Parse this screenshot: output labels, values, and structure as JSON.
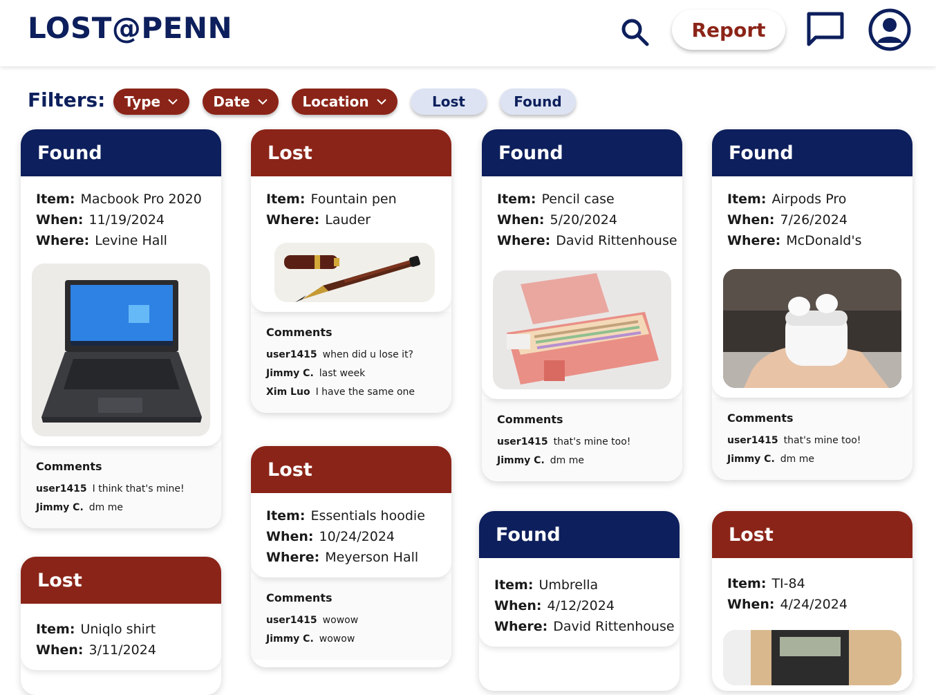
{
  "header": {
    "logo": "LOST@PENN",
    "report_label": "Report"
  },
  "filters": {
    "label": "Filters:",
    "type": "Type",
    "date": "Date",
    "location": "Location",
    "lost": "Lost",
    "found": "Found"
  },
  "colors": {
    "navy": "#0d1f5c",
    "maroon": "#8b2418",
    "chip_light": "#dde3f3"
  },
  "labels": {
    "item": "Item:",
    "when": "When:",
    "where": "Where:",
    "comments": "Comments"
  },
  "cards": [
    {
      "status": "Found",
      "item": "Macbook Pro 2020",
      "when": "11/19/2024",
      "where": "Levine Hall",
      "comments": [
        {
          "user": "user1415",
          "text": "I think that's mine!"
        },
        {
          "user": "Jimmy C.",
          "text": "dm me"
        }
      ]
    },
    {
      "status": "Lost",
      "item": "Uniqlo shirt",
      "when": "3/11/2024"
    },
    {
      "status": "Lost",
      "item": "Fountain pen",
      "where": "Lauder",
      "comments": [
        {
          "user": "user1415",
          "text": "when did u lose it?"
        },
        {
          "user": "Jimmy C.",
          "text": "last week"
        },
        {
          "user": "Xim Luo",
          "text": "I have the same one"
        }
      ]
    },
    {
      "status": "Lost",
      "item": "Essentials hoodie",
      "when": "10/24/2024",
      "where": "Meyerson Hall",
      "comments": [
        {
          "user": "user1415",
          "text": "wowow"
        },
        {
          "user": "Jimmy C.",
          "text": "wowow"
        }
      ]
    },
    {
      "status": "Found",
      "item": "Pencil case",
      "when": "5/20/2024",
      "where": "David Rittenhouse",
      "comments": [
        {
          "user": "user1415",
          "text": "that's mine too!"
        },
        {
          "user": "Jimmy C.",
          "text": "dm me"
        }
      ]
    },
    {
      "status": "Found",
      "item": "Umbrella",
      "when": "4/12/2024",
      "where": "David Rittenhouse"
    },
    {
      "status": "Found",
      "item": "Airpods Pro",
      "when": "7/26/2024",
      "where": "McDonald's",
      "comments": [
        {
          "user": "user1415",
          "text": "that's mine too!"
        },
        {
          "user": "Jimmy C.",
          "text": "dm me"
        }
      ]
    },
    {
      "status": "Lost",
      "item": "TI-84",
      "when": "4/24/2024"
    }
  ]
}
